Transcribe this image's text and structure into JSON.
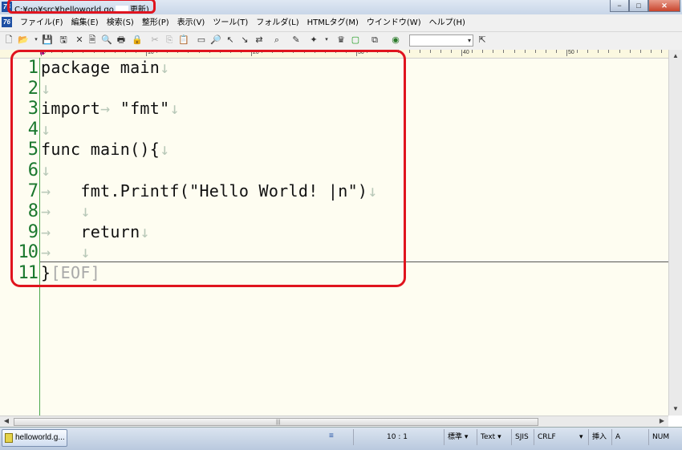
{
  "window": {
    "title": "C:¥go¥src¥helloworld.go",
    "title_extra": "更新)",
    "btn_min": "−",
    "btn_max": "□",
    "btn_close": "✕"
  },
  "menus": [
    "ファイル(F)",
    "編集(E)",
    "検索(S)",
    "整形(P)",
    "表示(V)",
    "ツール(T)",
    "フォルダ(L)",
    "HTMLタグ(M)",
    "ウインドウ(W)",
    "ヘルプ(H)"
  ],
  "ruler": [
    "0",
    "10",
    "20",
    "30",
    "40",
    "50"
  ],
  "code_lines": [
    {
      "n": "1",
      "text": "package main",
      "mark": "↓"
    },
    {
      "n": "2",
      "text": "",
      "mark": "↓"
    },
    {
      "n": "3",
      "text": "import",
      "tab": "→",
      "text2": " \"fmt\"",
      "mark": "↓"
    },
    {
      "n": "4",
      "text": "",
      "mark": "↓"
    },
    {
      "n": "5",
      "text": "func main(){",
      "mark": "↓"
    },
    {
      "n": "6",
      "text": "",
      "mark": "↓"
    },
    {
      "n": "7",
      "lead": "→",
      "text": "   fmt.Printf(\"Hello World! |n\")",
      "mark": "↓"
    },
    {
      "n": "8",
      "lead": "→",
      "text": "   ",
      "mark": "↓"
    },
    {
      "n": "9",
      "lead": "→",
      "text": "   return",
      "mark": "↓"
    },
    {
      "n": "10",
      "lead": "→",
      "text": "   ",
      "mark": "↓"
    },
    {
      "n": "11",
      "text": "}",
      "eof": "[EOF]"
    }
  ],
  "status": {
    "position": "10 : 1",
    "mode": "標準 ▾",
    "type": "Text ▾",
    "encoding": "SJIS",
    "eol": "CRLF",
    "eol_arrow": "▾",
    "insert": "挿入",
    "a": "A",
    "num": "NUM"
  },
  "taskbar": {
    "active_file": "helloworld.g..."
  },
  "scrollbar": {
    "up": "▲",
    "down": "▼",
    "left": "◀",
    "right": "▶",
    "grip": "|||"
  }
}
